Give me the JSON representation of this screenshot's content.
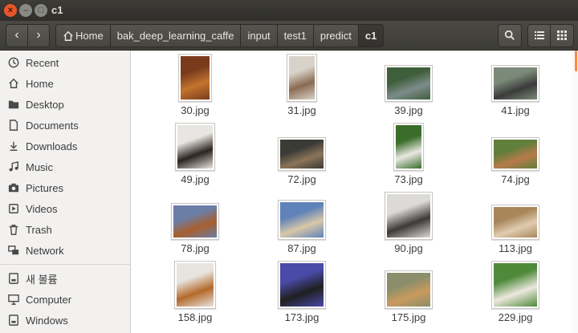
{
  "window": {
    "title": "c1"
  },
  "nav": {
    "back_glyph": "‹",
    "forward_glyph": "›"
  },
  "breadcrumbs": [
    {
      "label": "Home",
      "icon": "home-icon"
    },
    {
      "label": "bak_deep_learning_caffe"
    },
    {
      "label": "input"
    },
    {
      "label": "test1"
    },
    {
      "label": "predict"
    },
    {
      "label": "c1"
    }
  ],
  "toolbar": {
    "search_icon": "search-icon",
    "list_icon": "list-view-icon",
    "grid_icon": "grid-view-icon"
  },
  "sidebar": {
    "items": [
      {
        "label": "Recent",
        "icon": "clock-icon"
      },
      {
        "label": "Home",
        "icon": "home-icon"
      },
      {
        "label": "Desktop",
        "icon": "folder-icon"
      },
      {
        "label": "Documents",
        "icon": "document-icon"
      },
      {
        "label": "Downloads",
        "icon": "download-icon"
      },
      {
        "label": "Music",
        "icon": "music-icon"
      },
      {
        "label": "Pictures",
        "icon": "camera-icon"
      },
      {
        "label": "Videos",
        "icon": "video-icon"
      },
      {
        "label": "Trash",
        "icon": "trash-icon"
      },
      {
        "label": "Network",
        "icon": "network-icon"
      },
      {
        "label": "새 볼륨",
        "icon": "drive-icon"
      },
      {
        "label": "Computer",
        "icon": "computer-icon"
      },
      {
        "label": "Windows",
        "icon": "drive-icon"
      }
    ]
  },
  "files": [
    {
      "name": "30.jpg",
      "colors": [
        "#7a3b1d",
        "#c4742e"
      ]
    },
    {
      "name": "31.jpg",
      "colors": [
        "#d8d2c8",
        "#8a6a52"
      ]
    },
    {
      "name": "39.jpg",
      "colors": [
        "#3f5f3a",
        "#7d8c8a"
      ]
    },
    {
      "name": "41.jpg",
      "colors": [
        "#7b8a78",
        "#3b3b3b"
      ]
    },
    {
      "name": "49.jpg",
      "colors": [
        "#e8e6e2",
        "#2b2320"
      ]
    },
    {
      "name": "72.jpg",
      "colors": [
        "#3a3a36",
        "#8c7458"
      ]
    },
    {
      "name": "73.jpg",
      "colors": [
        "#3a6d2a",
        "#e9e7e2"
      ]
    },
    {
      "name": "74.jpg",
      "colors": [
        "#5f7f3a",
        "#b77b4a"
      ]
    },
    {
      "name": "78.jpg",
      "colors": [
        "#6b7ea6",
        "#a85f2e"
      ]
    },
    {
      "name": "87.jpg",
      "colors": [
        "#5f82b8",
        "#d7c8a8"
      ]
    },
    {
      "name": "90.jpg",
      "colors": [
        "#dcdad6",
        "#3c3a38"
      ]
    },
    {
      "name": "113.jpg",
      "colors": [
        "#a8865a",
        "#e0ccb0"
      ]
    },
    {
      "name": "158.jpg",
      "colors": [
        "#e7e3de",
        "#b36a2a"
      ]
    },
    {
      "name": "173.jpg",
      "colors": [
        "#4a4aa8",
        "#1f1f1f"
      ]
    },
    {
      "name": "175.jpg",
      "colors": [
        "#8a8e6a",
        "#c99a5e"
      ]
    },
    {
      "name": "229.jpg",
      "colors": [
        "#4f8a3a",
        "#ece8de"
      ]
    }
  ]
}
